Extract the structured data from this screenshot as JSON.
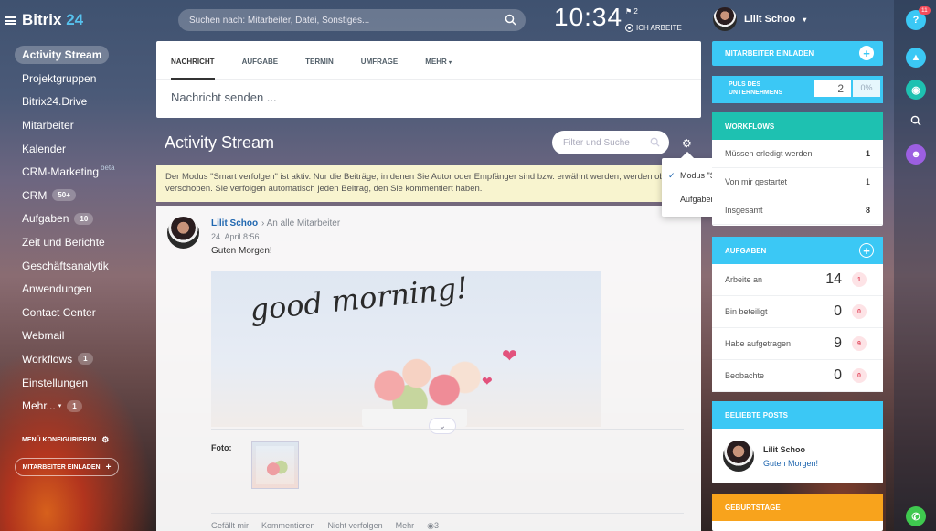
{
  "app": {
    "logo_name": "Bitrix",
    "logo_num": "24"
  },
  "search": {
    "placeholder": "Suchen nach: Mitarbeiter, Datei, Sonstiges..."
  },
  "clock": {
    "time": "10:34",
    "flag_count": "2",
    "status": "ICH ARBEITE"
  },
  "user": {
    "name": "Lilit Schoo"
  },
  "sidebar": {
    "items": [
      {
        "label": "Activity Stream"
      },
      {
        "label": "Projektgruppen"
      },
      {
        "label": "Bitrix24.Drive"
      },
      {
        "label": "Mitarbeiter"
      },
      {
        "label": "Kalender"
      },
      {
        "label": "CRM-Marketing",
        "sup": "beta"
      },
      {
        "label": "CRM",
        "badge": "50+"
      },
      {
        "label": "Aufgaben",
        "badge": "10"
      },
      {
        "label": "Zeit und Berichte"
      },
      {
        "label": "Geschäftsanalytik"
      },
      {
        "label": "Anwendungen"
      },
      {
        "label": "Contact Center"
      },
      {
        "label": "Webmail"
      },
      {
        "label": "Workflows",
        "badge": "1"
      },
      {
        "label": "Einstellungen"
      },
      {
        "label": "Mehr...",
        "badge": "1"
      }
    ],
    "configure": "MENÜ KONFIGURIEREN",
    "invite": "MITARBEITER EINLADEN"
  },
  "compose": {
    "tabs": [
      "NACHRICHT",
      "AUFGABE",
      "TERMIN",
      "UMFRAGE",
      "MEHR"
    ],
    "placeholder": "Nachricht senden ..."
  },
  "stream": {
    "title": "Activity Stream",
    "filter_placeholder": "Filter und Suche",
    "notice": "Der Modus \"Smart verfolgen\" ist aktiv. Nur die Beiträge, in denen Sie Autor oder Empfänger sind bzw. erwähnt werden, werden oben verschoben. Sie verfolgen automatisch jeden Beitrag, den Sie kommentiert haben."
  },
  "dropdown": {
    "items": [
      "Modus \"Smart verfolgen\"",
      "Aufgaben ausblenden"
    ]
  },
  "post": {
    "author": "Lilit Schoo",
    "to": "An alle Mitarbeiter",
    "date": "24. April 8:56",
    "text": "Guten Morgen!",
    "image_text": "good morning!",
    "photo_label": "Foto:",
    "actions": [
      "Gefällt mir",
      "Kommentieren",
      "Nicht verfolgen",
      "Mehr"
    ],
    "views": "3"
  },
  "right": {
    "invite": "MITARBEITER EINLADEN",
    "pulse": {
      "label": "PULS DES UNTERNEHMENS",
      "value": "2",
      "percent": "0%"
    },
    "workflows": {
      "title": "WORKFLOWS",
      "rows": [
        {
          "label": "Müssen erledigt werden",
          "count": "1"
        },
        {
          "label": "Von mir gestartet",
          "count": "1"
        },
        {
          "label": "Insgesamt",
          "count": "8"
        }
      ]
    },
    "tasks": {
      "title": "AUFGABEN",
      "rows": [
        {
          "label": "Arbeite an",
          "num": "14",
          "badge": "1"
        },
        {
          "label": "Bin beteiligt",
          "num": "0",
          "badge": "0"
        },
        {
          "label": "Habe aufgetragen",
          "num": "9",
          "badge": "9"
        },
        {
          "label": "Beobachte",
          "num": "0",
          "badge": "0"
        }
      ]
    },
    "popular": {
      "title": "BELIEBTE POSTS",
      "author": "Lilit Schoo",
      "text": "Guten Morgen!"
    },
    "birthdays": {
      "title": "GEBURTSTAGE"
    }
  },
  "rightbar": {
    "help_count": "11"
  },
  "colors": {
    "accent": "#3bc8f5",
    "workflows": "#1ec1b1",
    "birthdays": "#f8a31c",
    "link": "#2067b0",
    "notice": "#f8f4cf"
  }
}
